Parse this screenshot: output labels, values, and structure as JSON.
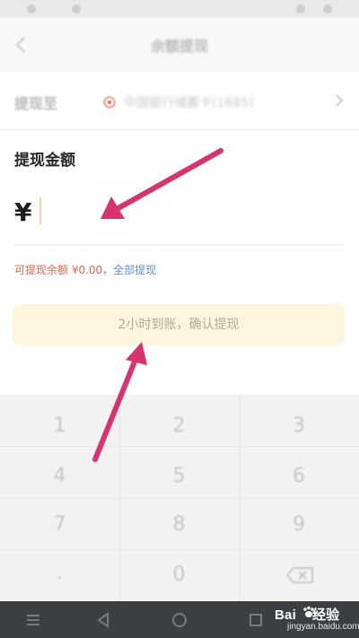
{
  "nav": {
    "title": "余额提现",
    "back_icon": "chevron-left-icon"
  },
  "withdraw_target": {
    "label": "提现至",
    "bank_name": "中国银行储蓄卡(1685)",
    "bank_icon": "bank-icon",
    "chevron_icon": "chevron-right-icon"
  },
  "amount": {
    "title": "提现金额",
    "currency_symbol": "¥",
    "value": "",
    "placeholder": ""
  },
  "balance": {
    "text": "可提现余额 ¥0.00，",
    "withdraw_all_label": "全部提现"
  },
  "confirm_button": {
    "label": "2小时到账，确认提现"
  },
  "keypad": {
    "keys": [
      "1",
      "2",
      "3",
      "4",
      "5",
      "6",
      "7",
      "8",
      "9",
      ".",
      "0"
    ],
    "delete_icon": "backspace-icon"
  },
  "system_nav": {
    "icons": [
      "menu-icon",
      "back-icon",
      "home-icon",
      "recents-icon"
    ]
  },
  "watermark": {
    "brand": "Bai",
    "brand_suffix": "经验",
    "site": "jingyan.baidu.com"
  },
  "colors": {
    "balance_text": "#e0674a",
    "link": "#5d8fc8",
    "confirm_bg": "#fdf5de",
    "annotation_arrow": "#d8336f"
  }
}
